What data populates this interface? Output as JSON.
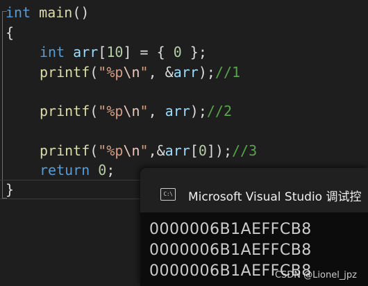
{
  "editor": {
    "lines": [
      [
        "int",
        " ",
        "main",
        "()"
      ],
      [
        "{"
      ],
      [
        "int",
        " ",
        "arr",
        "[",
        "10",
        "] = { ",
        "0",
        " };"
      ],
      [
        "printf",
        "(",
        "\"%p",
        "\\n",
        "\"",
        ", &",
        "arr",
        ");",
        "//1"
      ],
      [],
      [
        "printf",
        "(",
        "\"%p",
        "\\n",
        "\"",
        ", ",
        "arr",
        ");",
        "//2"
      ],
      [],
      [
        "printf",
        "(",
        "\"%p",
        "\\n",
        "\"",
        ",&",
        "arr",
        "[",
        "0",
        "]);",
        "//3"
      ],
      [
        "return",
        " ",
        "0",
        ";"
      ],
      [
        "}"
      ]
    ]
  },
  "console": {
    "icon_text": "C:\\",
    "title": "Microsoft Visual Studio 调试控",
    "output": [
      "0000006B1AEFFCB8",
      "0000006B1AEFFCB8",
      "0000006B1AEFFCB8"
    ]
  },
  "watermark": "CSDN @Lionel_jpz",
  "colors": {
    "background": "#1e1e1e",
    "keyword": "#569cd6",
    "function": "#dcdcaa",
    "variable": "#9cdcfe",
    "number": "#b5cea8",
    "string": "#d69d85",
    "comment": "#57a64a",
    "console_bg": "#0c0c0c",
    "console_titlebar": "#202020"
  }
}
